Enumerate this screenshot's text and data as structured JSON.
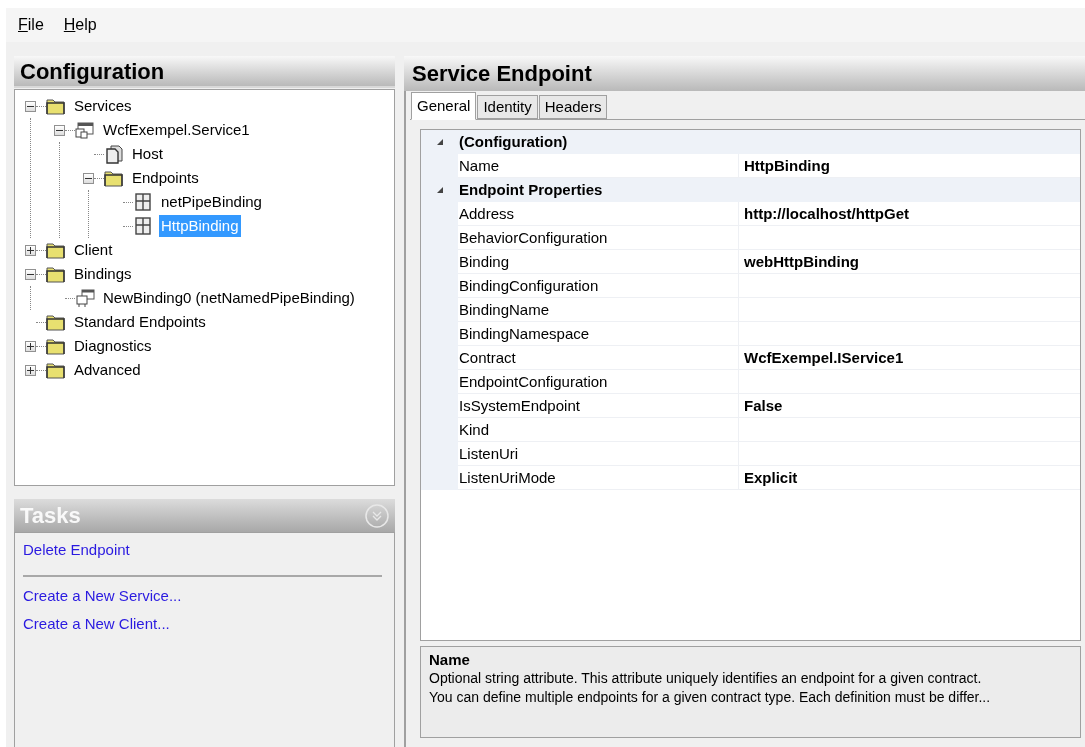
{
  "menu": [
    {
      "label": "File"
    },
    {
      "label": "Help"
    }
  ],
  "configuration": {
    "title": "Configuration",
    "tree": [
      {
        "label": "Services",
        "kind": "folder",
        "expanded": true,
        "selected": false,
        "children": [
          {
            "label": "WcfExempel.Service1",
            "kind": "service",
            "expanded": true,
            "selected": false,
            "children": [
              {
                "label": "Host",
                "kind": "host",
                "selected": false
              },
              {
                "label": "Endpoints",
                "kind": "folder",
                "expanded": true,
                "selected": false,
                "children": [
                  {
                    "label": "netPipeBinding",
                    "kind": "endpoint",
                    "selected": false
                  },
                  {
                    "label": "HttpBinding",
                    "kind": "endpoint",
                    "selected": true
                  }
                ]
              }
            ]
          }
        ]
      },
      {
        "label": "Client",
        "kind": "folder",
        "expanded": false,
        "selected": false
      },
      {
        "label": "Bindings",
        "kind": "folder",
        "expanded": true,
        "selected": false,
        "children": [
          {
            "label": "NewBinding0 (netNamedPipeBinding)",
            "kind": "binding",
            "selected": false
          }
        ]
      },
      {
        "label": "Standard Endpoints",
        "kind": "folder",
        "selected": false
      },
      {
        "label": "Diagnostics",
        "kind": "folder",
        "expanded": false,
        "selected": false
      },
      {
        "label": "Advanced",
        "kind": "folder",
        "expanded": false,
        "selected": false
      }
    ]
  },
  "tasks": {
    "title": "Tasks",
    "groups": [
      [
        "Delete Endpoint"
      ],
      [
        "Create a New Service...",
        "Create a New Client..."
      ]
    ]
  },
  "service_endpoint": {
    "title": "Service Endpoint",
    "tabs": [
      {
        "label": "General",
        "selected": true
      },
      {
        "label": "Identity",
        "selected": false
      },
      {
        "label": "Headers",
        "selected": false
      }
    ],
    "categories": [
      {
        "name": "(Configuration)",
        "expanded": true,
        "rows": [
          {
            "name": "Name",
            "value": "HttpBinding"
          }
        ]
      },
      {
        "name": "Endpoint Properties",
        "expanded": true,
        "rows": [
          {
            "name": "Address",
            "value": "http://localhost/httpGet"
          },
          {
            "name": "BehaviorConfiguration"
          },
          {
            "name": "Binding",
            "value": "webHttpBinding"
          },
          {
            "name": "BindingConfiguration"
          },
          {
            "name": "BindingName"
          },
          {
            "name": "BindingNamespace"
          },
          {
            "name": "Contract",
            "value": "WcfExempel.IService1"
          },
          {
            "name": "EndpointConfiguration"
          },
          {
            "name": "IsSystemEndpoint",
            "value": "False"
          },
          {
            "name": "Kind"
          },
          {
            "name": "ListenUri"
          },
          {
            "name": "ListenUriMode",
            "value": "Explicit"
          }
        ]
      }
    ],
    "description": {
      "title": "Name",
      "lines": [
        "Optional string attribute. This attribute uniquely identifies an endpoint for a given contract.",
        "You can define multiple endpoints for a given contract type. Each definition must be differ..."
      ]
    }
  }
}
